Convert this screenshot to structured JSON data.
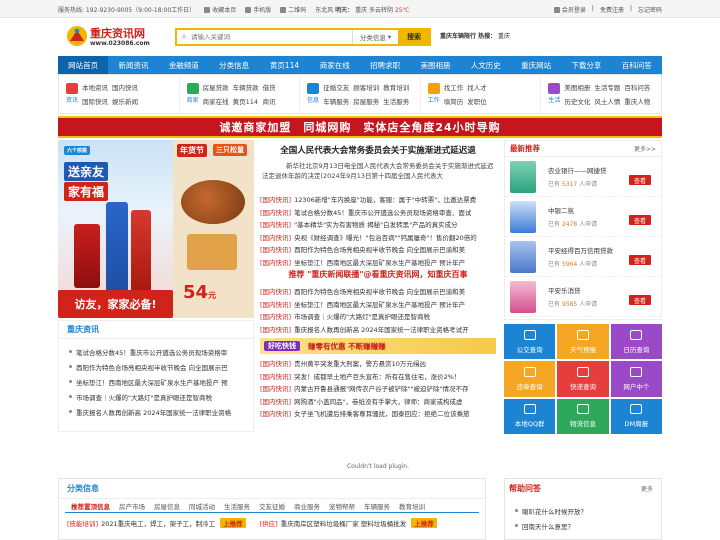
{
  "topbar": {
    "hotline": "服务热线: 192-9230-9005（9:00-18:00工作日）",
    "bookmark": "收藏本页",
    "mobile": "手机版",
    "qrcode": "二维码",
    "city": "东北风",
    "weather_prefix": "明天：",
    "weather_text": "重庆 多云转阴",
    "temp": "25℃",
    "login": "会员登录",
    "register": "免费注册",
    "forgot": "忘记密码"
  },
  "header": {
    "logo_name": "重庆资讯网",
    "logo_url": "www.023086.com",
    "search_placeholder": "请输入关键词",
    "search_category": "分类信息",
    "search_button": "搜索",
    "hot_label": "重庆车辆限行 热搜：",
    "hot_term": "重庆"
  },
  "nav": [
    "网站首页",
    "新闻资讯",
    "金融频道",
    "分类信息",
    "黄页114",
    "商家在线",
    "招聘求职",
    "美图相册",
    "人文历史",
    "重庆网站",
    "下载分享",
    "百科问答"
  ],
  "subnav": [
    {
      "label": "资讯",
      "links": [
        "本地资讯",
        "国内快讯",
        "",
        "国际快讯",
        "娱乐新闻",
        ""
      ],
      "color": "#e63d3d"
    },
    {
      "label": "商家",
      "links": [
        "房屋贷款",
        "车辆贷款",
        "借贷",
        "商家在线",
        "黄页114",
        "商讯"
      ],
      "color": "#2ea95b"
    },
    {
      "label": "信息",
      "links": [
        "征婚交友",
        "顾客培训",
        "教育培训",
        "车辆服务",
        "房屋服务",
        "生活服务"
      ],
      "color": "#1d84d4"
    },
    {
      "label": "工作",
      "links": [
        "找工作",
        "找人才",
        "",
        "填简历",
        "发职位",
        ""
      ],
      "color": "#f2a100"
    },
    {
      "label": "生活",
      "links": [
        "美图相册",
        "生活专题",
        "百科问答",
        "历史文化",
        "风土人情",
        "重庆人物"
      ],
      "color": "#9a49c7"
    }
  ],
  "banner": "诚邀商家加盟　同城网购　实体店全角度24小时导购",
  "promo": {
    "tag1": "送亲友",
    "tag2": "家有福",
    "tag3": "访友，家家必备!",
    "tag4": "年货节",
    "tag5": "三只松鼠",
    "price": "54",
    "price_unit": "元"
  },
  "center": {
    "headline": "全国人民代表大会常务委员会关于实施渐进式延迟退",
    "lead": "新华社北京9月13日电全国人民代表大会常务委员会关于实施渐进式延迟法定退休年龄的决定(2024年9月13日第十四届全国人民代表大",
    "list1": [
      {
        "tag": "[国内快讯]",
        "text": "12306新增\"车内换座\"功能，客服：属于\"中转票\"，比邀达票费"
      },
      {
        "tag": "[国内快讯]",
        "text": "笔试合格分数45！重庆市公开遴选公务员现场资格审查、面试"
      },
      {
        "tag": "[国内快讯]",
        "text": "\"基本精华\"实为有害物质 揭秘\"白发转黑\"产品的真实成分"
      },
      {
        "tag": "[国内快讯]",
        "text": "央视《财经调查》曝光！\"包治百病\"\"钙属屡奇\"！售价翻20倍的"
      },
      {
        "tag": "[国内快讯]",
        "text": "酉阳作为特色合场亮相央视半收节晚会 向全国展示巴渝和美"
      },
      {
        "tag": "[国内快讯]",
        "text": "坐标垫江！西南地区最大深层矿泉水生产基地投产 预计年产"
      }
    ],
    "push": "推荐 \"重庆新闻联播\"@看重庆资讯网，知重庆百事",
    "list2": [
      {
        "tag": "[国内快讯]",
        "text": "酉阳作为特色合场亮相央视半收节晚会 向全国展示巴渝和美"
      },
      {
        "tag": "[国内快讯]",
        "text": "坐标垫江！西南地区最大深层矿泉水生产基地投产 预计年产"
      },
      {
        "tag": "[国内快讯]",
        "text": "市场调查｜火爆的\"大路灯\"是真护眼还是智商税"
      },
      {
        "tag": "[国内快讯]",
        "text": "重庆报名人数再创新高 2024年国家统一法律职业资格考试开"
      }
    ],
    "ad_logo": "好吃快钱",
    "ad_text": "赚零有优惠 不断赚赚赚",
    "list3": [
      {
        "tag": "[国内快讯]",
        "text": "贵州黄平突发重大刑案，警方悬赏10万元缉凶"
      },
      {
        "tag": "[国内快讯]",
        "text": "突发！成都早土地产巨头宣布：所有在售住宅，涨价2%！"
      },
      {
        "tag": "[国内快讯]",
        "text": "内蒙古开鲁县通报\"网传农户谷子被铲除\"\"被迫铲除\"情况不存"
      },
      {
        "tag": "[国内快讯]",
        "text": "网购酒\"小盖同品\"，卷纸没有手掌大，律师：商家或构成虚"
      },
      {
        "tag": "[国内快讯]",
        "text": "女子坐飞机遭后排乘客尊耳骚扰，国泰回应：拒绝二位该乘旅"
      }
    ],
    "plugin_msg": "Couldn't load plugin."
  },
  "left_news": {
    "title": "重庆资讯",
    "items": [
      "笔试合格分数45！重庆市公开遴选公务员现场资格审",
      "酉阳作为特色合场亮相央视半收节晚会 向全国展示巴",
      "坐标垫江！西南地区最大深层矿泉水生产基地投产 预",
      "市场调查｜火爆的\"大路灯\"是真护眼还是智商税",
      "重庆报名人数再创新高 2024年国家统一法律职业资格"
    ]
  },
  "recommend": {
    "title": "最新推荐",
    "more": "更多>>",
    "apps": [
      {
        "name": "农业银行——网捷贷",
        "count_prefix": "已有",
        "count": "5317",
        "count_suffix": "人申请",
        "view": "查看",
        "color": "#2aa27c"
      },
      {
        "name": "中银二氛",
        "count_prefix": "已有",
        "count": "2478",
        "count_suffix": "人申请",
        "view": "查看",
        "color": "#3a7bd5"
      },
      {
        "name": "平安经得百万信用贷款",
        "count_prefix": "已有",
        "count": "5964",
        "count_suffix": "人申请",
        "view": "查看",
        "color": "#4a78c8"
      },
      {
        "name": "平安乐消贷",
        "count_prefix": "已有",
        "count": "9585",
        "count_suffix": "人申请",
        "view": "查看",
        "color": "#d44f8c"
      }
    ]
  },
  "tiles": [
    {
      "label": "公交查询",
      "color": "#1d84d4"
    },
    {
      "label": "天气预报",
      "color": "#f5a623"
    },
    {
      "label": "日历查询",
      "color": "#9a49c7"
    },
    {
      "label": "违章查询",
      "color": "#f5a623"
    },
    {
      "label": "快递查询",
      "color": "#e63d3d"
    },
    {
      "label": "网户中个",
      "color": "#9a49c7"
    },
    {
      "label": "本地QQ群",
      "color": "#1d84d4"
    },
    {
      "label": "物流信息",
      "color": "#2ea95b"
    },
    {
      "label": "DM周报",
      "color": "#1d84d4"
    }
  ],
  "classified": {
    "title": "分类信息",
    "tabs": [
      "推荐置顶信息",
      "房产市场",
      "房屋信息",
      "同城活动",
      "生活服务",
      "交友征婚",
      "商业服务",
      "宠物帮帮",
      "车辆服务",
      "教育培训"
    ],
    "items": [
      {
        "cat": "[技能培训]",
        "text": "2021重庆电工，焊工，架子工，制冷工",
        "badge": "上推荐"
      },
      {
        "cat": "[供应]",
        "text": "重庆南岸区塑料垃圾桶厂家 塑料垃圾桶批发",
        "badge": "上推荐"
      }
    ]
  },
  "help": {
    "title": "帮助问答",
    "more": "更多",
    "items": [
      "喇叭花什么时候开放？",
      "回南天什么意思？"
    ]
  }
}
